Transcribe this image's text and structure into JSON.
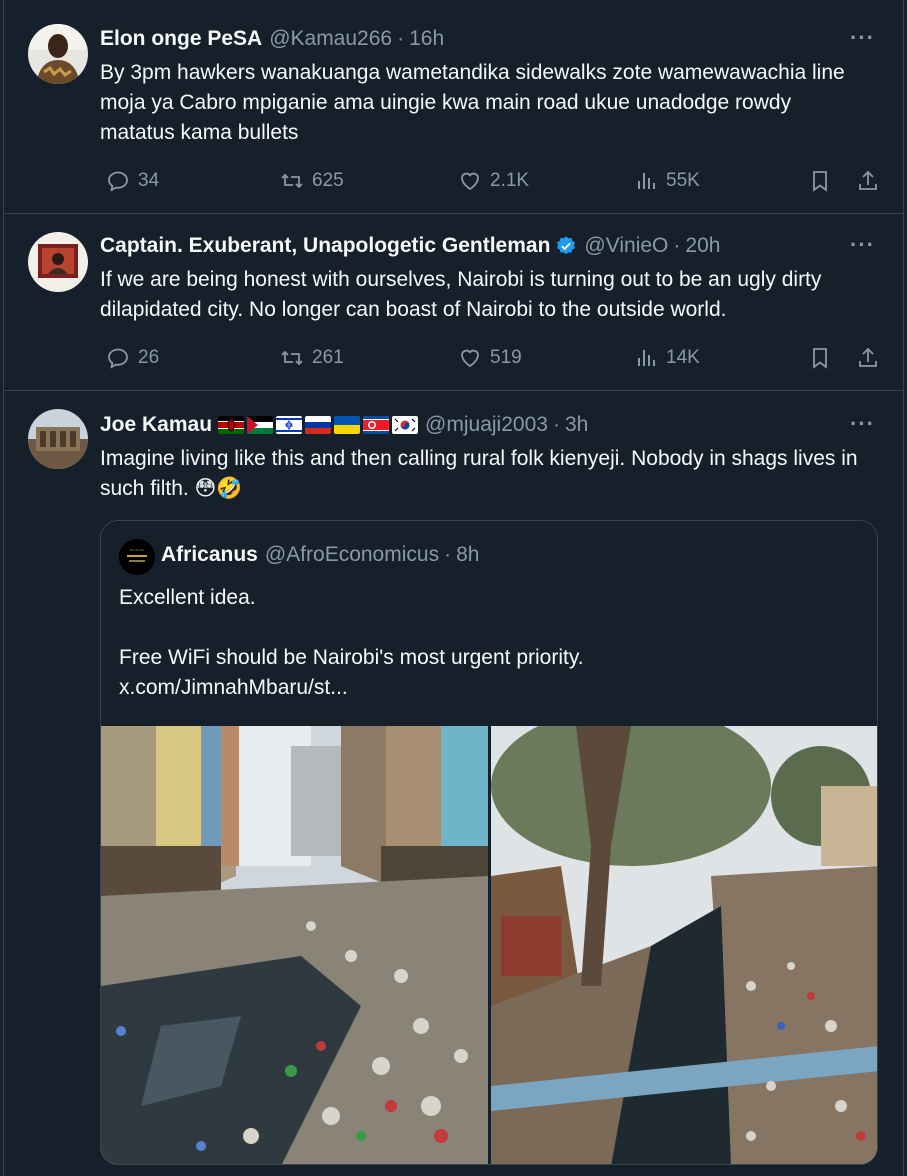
{
  "tweets": [
    {
      "name": "Elon onge PeSA",
      "handle": "@Kamau266",
      "time": "16h",
      "text": "By 3pm hawkers wanakuanga wametandika sidewalks zote wamewawachia line moja ya Cabro mpiganie ama uingie kwa main road ukue unadodge rowdy matatus kama bullets",
      "replies": "34",
      "retweets": "625",
      "likes": "2.1K",
      "views": "55K"
    },
    {
      "name": "Captain. Exuberant, Unapologetic Gentleman",
      "handle": "@VinieO",
      "time": "20h",
      "verified": true,
      "text": "If we are being honest with ourselves, Nairobi is turning out to be an ugly dirty dilapidated city. No longer can boast of Nairobi to the outside world.",
      "replies": "26",
      "retweets": "261",
      "likes": "519",
      "views": "14K"
    },
    {
      "name": "Joe Kamau",
      "handle": "@mjuaji2003",
      "time": "3h",
      "flags": [
        "kenya",
        "palestine",
        "israel",
        "russia",
        "ukraine",
        "north-korea",
        "south-korea"
      ],
      "text": "Imagine living like this and then calling rural folk kienyeji. Nobody in shags lives in such filth. 😳🤣",
      "quote": {
        "name": "Africanus",
        "handle": "@AfroEconomicus",
        "time": "8h",
        "line1": "Excellent idea.",
        "line2": "Free WiFi should be Nairobi's most urgent priority.",
        "link": "x.com/JimnahMbaru/st...",
        "images": [
          "street-garbage-photo",
          "river-garbage-photo"
        ]
      }
    }
  ],
  "ui": {
    "separator": "·",
    "more": "···",
    "icons": [
      "reply-icon",
      "retweet-icon",
      "like-icon",
      "views-icon",
      "bookmark-icon",
      "share-icon",
      "more-icon",
      "verified-badge-icon"
    ],
    "colors": {
      "background": "#15202b",
      "text": "#f7f9f9",
      "muted": "#8b98a5",
      "border": "#38444d",
      "verified": "#1d9bf0"
    }
  }
}
